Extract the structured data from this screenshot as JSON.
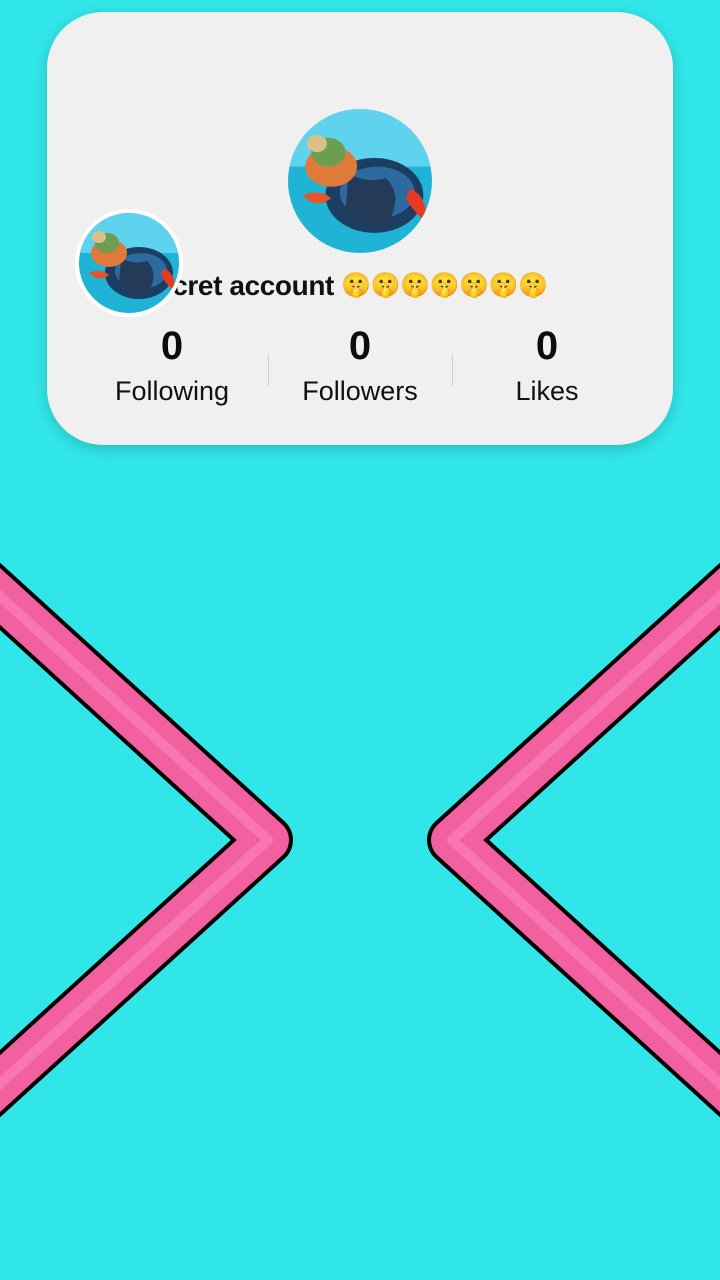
{
  "profile": {
    "username": "cret account",
    "emojis": "🤫🤫🤫🤫🤫🤫🤫",
    "avatar_icon": "sea-turtle-photo"
  },
  "stats": [
    {
      "value": "0",
      "label": "Following"
    },
    {
      "value": "0",
      "label": "Followers"
    },
    {
      "value": "0",
      "label": "Likes"
    }
  ],
  "colors": {
    "background": "#31e6e8",
    "card": "#f0f0f0",
    "chevron_fill": "#f2609f",
    "chevron_outline": "#000000"
  }
}
